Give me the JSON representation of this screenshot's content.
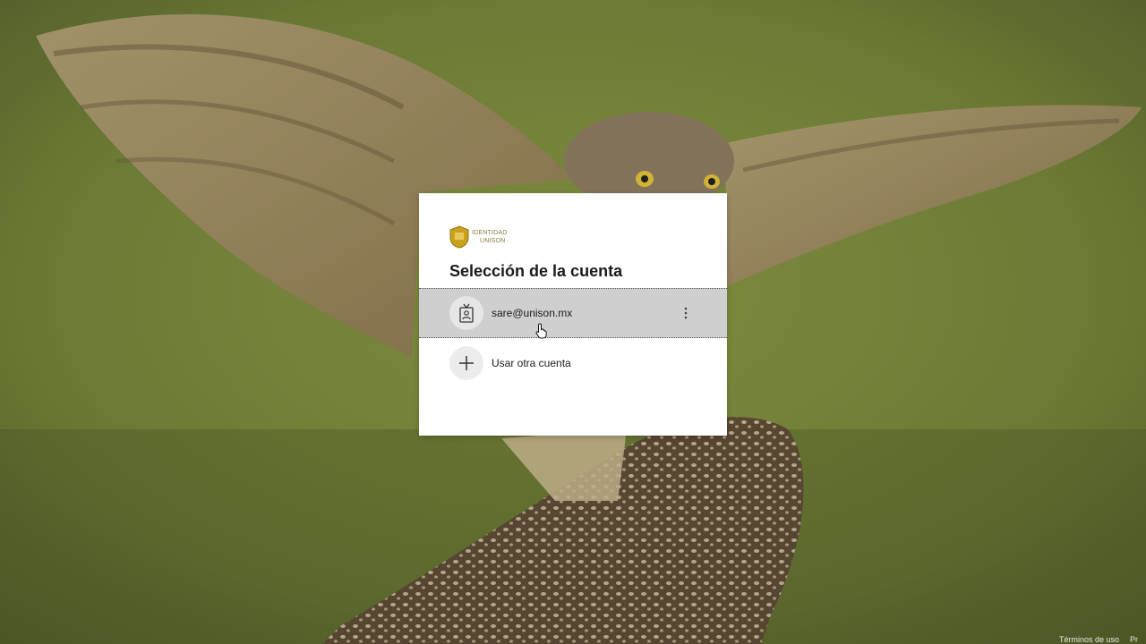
{
  "logo": {
    "line1": "IDENTIDAD",
    "line2": "UNISON"
  },
  "dialog": {
    "title": "Selección de la cuenta"
  },
  "accounts": [
    {
      "label": "sare@unison.mx",
      "icon": "badge-icon",
      "selected": true
    },
    {
      "label": "Usar otra cuenta",
      "icon": "plus-icon",
      "selected": false
    }
  ],
  "footer": {
    "terms": "Términos de uso",
    "privacy": "Pr"
  },
  "colors": {
    "selected_row": "#cfcfcf",
    "logo_gold": "#c9a21c"
  }
}
